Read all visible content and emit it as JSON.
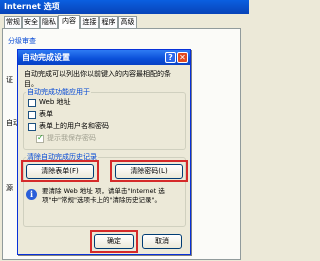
{
  "background_window": {
    "title": "Internet 选项",
    "tabs": [
      "常规",
      "安全",
      "隐私",
      "内容",
      "连接",
      "程序",
      "高级"
    ],
    "active_tab": "内容",
    "section_label": "分级审查",
    "left_edge_labels": [
      "证",
      "自动",
      "源"
    ]
  },
  "dialog": {
    "title": "自动完成设置",
    "help_glyph": "?",
    "close_glyph": "✕",
    "description": "自动完成可以列出你以前键入的内容最相配的条目。",
    "group_use_title": "自动完成功能应用于",
    "options": [
      {
        "label": "Web 地址",
        "checked": false,
        "disabled": false
      },
      {
        "label": "表单",
        "checked": false,
        "disabled": false
      },
      {
        "label": "表单上的用户名和密码",
        "checked": false,
        "disabled": false
      },
      {
        "label": "提示我保存密码",
        "checked": true,
        "disabled": true
      }
    ],
    "group_clear_title": "清除自动完成历史记录",
    "clear_forms_button": "清除表单(F)",
    "clear_passwords_button": "清除密码(L)",
    "info_text": "要清除 Web 地址 项，请单击\"Internet 选项\"中\"常规\"选项卡上的\"清除历史记录\"。",
    "ok_button": "确定",
    "cancel_button": "取消",
    "highlight_color": "#d52a2a"
  }
}
